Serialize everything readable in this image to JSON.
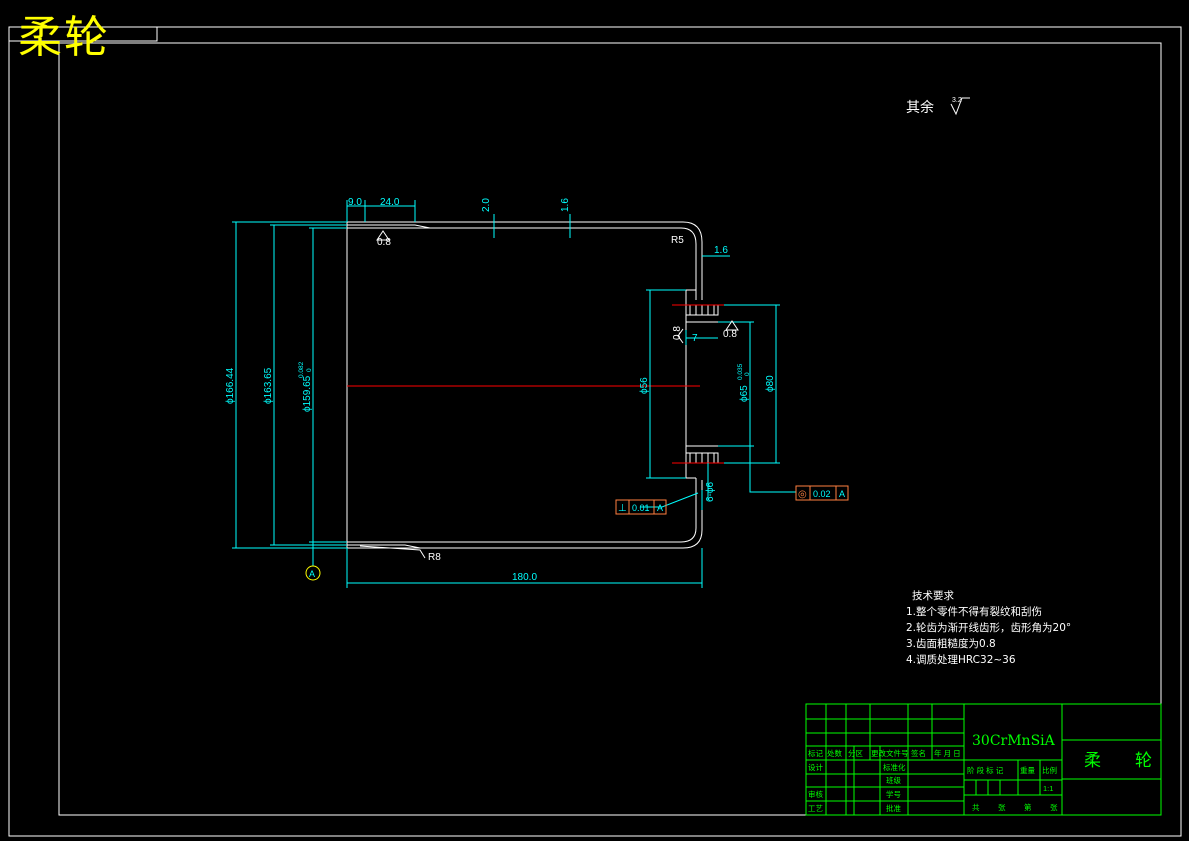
{
  "drawing": {
    "stamp_title": "柔轮",
    "roughness_note": "其余",
    "roughness_value": "3.2",
    "dimensions": {
      "d_outer": "ϕ166.44",
      "d_mid": "ϕ163.65",
      "d_inner": "ϕ159.65",
      "d_inner_tol_upper": "0.082",
      "d_inner_tol_lower": "0",
      "d_hub": "ϕ56",
      "d_bore": "ϕ65",
      "d_bore_tol_upper": "0.035",
      "d_bore_tol_lower": "0",
      "d_pcd": "ϕ80",
      "len_9": "9.0",
      "len_24": "24.0",
      "thk_2": "2.0",
      "thk_16a": "1.6",
      "thk_16b": "1.6",
      "len_7": "7",
      "len_180": "180.0",
      "holes": "6-ϕ6",
      "radius_r5": "R5",
      "radius_r8": "R8",
      "rough_08a": "0.8",
      "rough_08b": "0.8",
      "rough_08c": "0.8",
      "datum": "A"
    },
    "tolerance_perp": {
      "symbol": "⊥",
      "value": "0.01",
      "datum": "A"
    },
    "tolerance_conc": {
      "symbol": "◎",
      "value": "0.02",
      "datum": "A"
    },
    "tech_requirements": {
      "heading": "技术要求",
      "items": [
        "1.整个零件不得有裂纹和刮伤",
        "2.轮齿为渐开线齿形，齿形角为20°",
        "3.齿面粗糙度为0.8",
        "4.调质处理HRC32~36"
      ]
    },
    "title_block": {
      "material": "30CrMnSiA",
      "part_name": "柔　　轮",
      "col_labels": [
        "标记",
        "处数",
        "分区",
        "更改文件号",
        "签名",
        "年 月 日"
      ],
      "row_labels": [
        "设计",
        "审核",
        "工艺"
      ],
      "mid_labels": [
        "标准化",
        "班级",
        "学号",
        "批准"
      ],
      "stage_labels": [
        "阶 段 标 记",
        "重量",
        "比例"
      ],
      "scale": "1:1",
      "sheet_labels": [
        "共",
        "张",
        "第",
        "张"
      ]
    },
    "colors": {
      "outline": "#ffffff",
      "dimension": "#00ffff",
      "titleblock": "#00ff00",
      "centerline": "#ff0000",
      "stamp": "#ffff00",
      "tolerance_frame": "#ff8040"
    }
  }
}
